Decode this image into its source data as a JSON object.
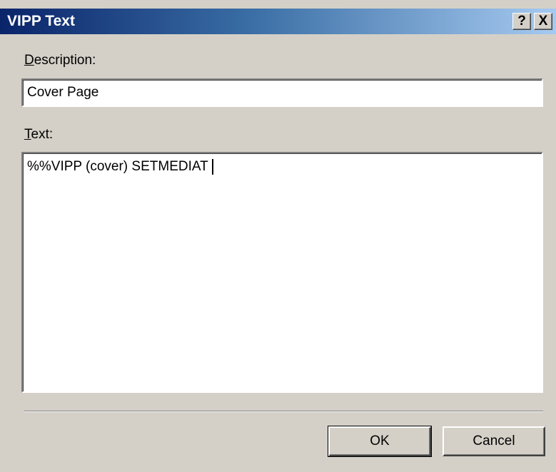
{
  "window": {
    "title": "VIPP Text",
    "help_glyph": "?",
    "close_glyph": "X"
  },
  "description": {
    "label_accel": "D",
    "label_rest": "escription:",
    "value": "Cover Page"
  },
  "text": {
    "label_accel": "T",
    "label_rest": "ext:",
    "value": "%%VIPP (cover) SETMEDIAT"
  },
  "buttons": {
    "ok": "OK",
    "cancel": "Cancel"
  }
}
